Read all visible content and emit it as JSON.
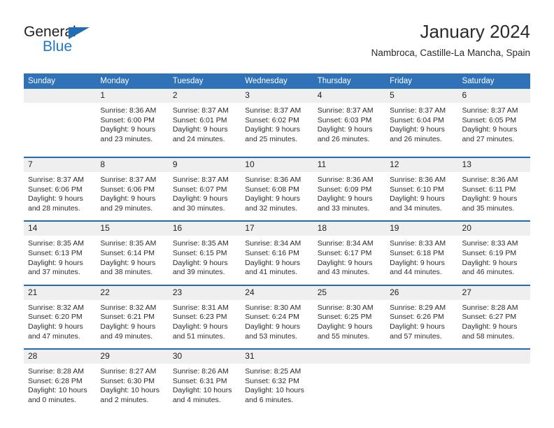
{
  "brand": {
    "name_part1": "General",
    "name_part2": "Blue",
    "triangle_icon": "triangle-icon",
    "accent_color": "#1f6db5",
    "blue_text_color": "#1f78c1"
  },
  "header": {
    "title": "January 2024",
    "subtitle": "Nambroca, Castille-La Mancha, Spain"
  },
  "calendar": {
    "header_bg": "#2f72b8",
    "daynum_bg": "#efefef",
    "row_divider_color": "#1f6db5",
    "weekday_headers": [
      "Sunday",
      "Monday",
      "Tuesday",
      "Wednesday",
      "Thursday",
      "Friday",
      "Saturday"
    ],
    "weeks": [
      [
        {
          "day": "",
          "lines": []
        },
        {
          "day": "1",
          "lines": [
            "Sunrise: 8:36 AM",
            "Sunset: 6:00 PM",
            "Daylight: 9 hours and 23 minutes."
          ]
        },
        {
          "day": "2",
          "lines": [
            "Sunrise: 8:37 AM",
            "Sunset: 6:01 PM",
            "Daylight: 9 hours and 24 minutes."
          ]
        },
        {
          "day": "3",
          "lines": [
            "Sunrise: 8:37 AM",
            "Sunset: 6:02 PM",
            "Daylight: 9 hours and 25 minutes."
          ]
        },
        {
          "day": "4",
          "lines": [
            "Sunrise: 8:37 AM",
            "Sunset: 6:03 PM",
            "Daylight: 9 hours and 26 minutes."
          ]
        },
        {
          "day": "5",
          "lines": [
            "Sunrise: 8:37 AM",
            "Sunset: 6:04 PM",
            "Daylight: 9 hours and 26 minutes."
          ]
        },
        {
          "day": "6",
          "lines": [
            "Sunrise: 8:37 AM",
            "Sunset: 6:05 PM",
            "Daylight: 9 hours and 27 minutes."
          ]
        }
      ],
      [
        {
          "day": "7",
          "lines": [
            "Sunrise: 8:37 AM",
            "Sunset: 6:06 PM",
            "Daylight: 9 hours and 28 minutes."
          ]
        },
        {
          "day": "8",
          "lines": [
            "Sunrise: 8:37 AM",
            "Sunset: 6:06 PM",
            "Daylight: 9 hours and 29 minutes."
          ]
        },
        {
          "day": "9",
          "lines": [
            "Sunrise: 8:37 AM",
            "Sunset: 6:07 PM",
            "Daylight: 9 hours and 30 minutes."
          ]
        },
        {
          "day": "10",
          "lines": [
            "Sunrise: 8:36 AM",
            "Sunset: 6:08 PM",
            "Daylight: 9 hours and 32 minutes."
          ]
        },
        {
          "day": "11",
          "lines": [
            "Sunrise: 8:36 AM",
            "Sunset: 6:09 PM",
            "Daylight: 9 hours and 33 minutes."
          ]
        },
        {
          "day": "12",
          "lines": [
            "Sunrise: 8:36 AM",
            "Sunset: 6:10 PM",
            "Daylight: 9 hours and 34 minutes."
          ]
        },
        {
          "day": "13",
          "lines": [
            "Sunrise: 8:36 AM",
            "Sunset: 6:11 PM",
            "Daylight: 9 hours and 35 minutes."
          ]
        }
      ],
      [
        {
          "day": "14",
          "lines": [
            "Sunrise: 8:35 AM",
            "Sunset: 6:13 PM",
            "Daylight: 9 hours and 37 minutes."
          ]
        },
        {
          "day": "15",
          "lines": [
            "Sunrise: 8:35 AM",
            "Sunset: 6:14 PM",
            "Daylight: 9 hours and 38 minutes."
          ]
        },
        {
          "day": "16",
          "lines": [
            "Sunrise: 8:35 AM",
            "Sunset: 6:15 PM",
            "Daylight: 9 hours and 39 minutes."
          ]
        },
        {
          "day": "17",
          "lines": [
            "Sunrise: 8:34 AM",
            "Sunset: 6:16 PM",
            "Daylight: 9 hours and 41 minutes."
          ]
        },
        {
          "day": "18",
          "lines": [
            "Sunrise: 8:34 AM",
            "Sunset: 6:17 PM",
            "Daylight: 9 hours and 43 minutes."
          ]
        },
        {
          "day": "19",
          "lines": [
            "Sunrise: 8:33 AM",
            "Sunset: 6:18 PM",
            "Daylight: 9 hours and 44 minutes."
          ]
        },
        {
          "day": "20",
          "lines": [
            "Sunrise: 8:33 AM",
            "Sunset: 6:19 PM",
            "Daylight: 9 hours and 46 minutes."
          ]
        }
      ],
      [
        {
          "day": "21",
          "lines": [
            "Sunrise: 8:32 AM",
            "Sunset: 6:20 PM",
            "Daylight: 9 hours and 47 minutes."
          ]
        },
        {
          "day": "22",
          "lines": [
            "Sunrise: 8:32 AM",
            "Sunset: 6:21 PM",
            "Daylight: 9 hours and 49 minutes."
          ]
        },
        {
          "day": "23",
          "lines": [
            "Sunrise: 8:31 AM",
            "Sunset: 6:23 PM",
            "Daylight: 9 hours and 51 minutes."
          ]
        },
        {
          "day": "24",
          "lines": [
            "Sunrise: 8:30 AM",
            "Sunset: 6:24 PM",
            "Daylight: 9 hours and 53 minutes."
          ]
        },
        {
          "day": "25",
          "lines": [
            "Sunrise: 8:30 AM",
            "Sunset: 6:25 PM",
            "Daylight: 9 hours and 55 minutes."
          ]
        },
        {
          "day": "26",
          "lines": [
            "Sunrise: 8:29 AM",
            "Sunset: 6:26 PM",
            "Daylight: 9 hours and 57 minutes."
          ]
        },
        {
          "day": "27",
          "lines": [
            "Sunrise: 8:28 AM",
            "Sunset: 6:27 PM",
            "Daylight: 9 hours and 58 minutes."
          ]
        }
      ],
      [
        {
          "day": "28",
          "lines": [
            "Sunrise: 8:28 AM",
            "Sunset: 6:28 PM",
            "Daylight: 10 hours and 0 minutes."
          ]
        },
        {
          "day": "29",
          "lines": [
            "Sunrise: 8:27 AM",
            "Sunset: 6:30 PM",
            "Daylight: 10 hours and 2 minutes."
          ]
        },
        {
          "day": "30",
          "lines": [
            "Sunrise: 8:26 AM",
            "Sunset: 6:31 PM",
            "Daylight: 10 hours and 4 minutes."
          ]
        },
        {
          "day": "31",
          "lines": [
            "Sunrise: 8:25 AM",
            "Sunset: 6:32 PM",
            "Daylight: 10 hours and 6 minutes."
          ]
        },
        {
          "day": "",
          "lines": []
        },
        {
          "day": "",
          "lines": []
        },
        {
          "day": "",
          "lines": []
        }
      ]
    ]
  }
}
